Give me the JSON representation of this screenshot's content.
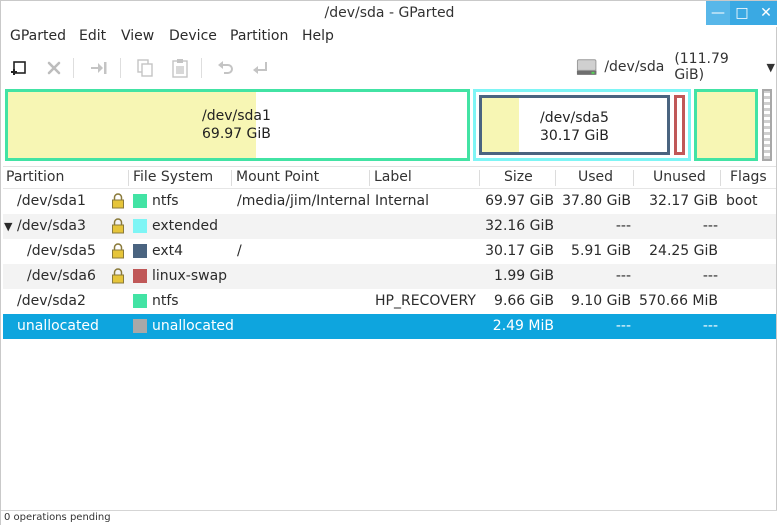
{
  "window": {
    "title": "/dev/sda - GParted"
  },
  "menu": [
    "GParted",
    "Edit",
    "View",
    "Device",
    "Partition",
    "Help"
  ],
  "toolbar": {
    "icons": [
      "new-partition-icon",
      "delete-icon",
      "resize-move-icon",
      "copy-icon",
      "paste-icon",
      "undo-icon",
      "apply-icon"
    ]
  },
  "device": {
    "name": "/dev/sda",
    "size": "(111.79 GiB)"
  },
  "disk_map": {
    "sda1": {
      "name": "/dev/sda1",
      "size": "69.97 GiB",
      "used_fraction": 0.54
    },
    "sda5": {
      "name": "/dev/sda5",
      "size": "30.17 GiB",
      "used_fraction": 0.2
    }
  },
  "colors": {
    "ntfs": "#42e3a4",
    "extended": "#7ef5f5",
    "ext4": "#4a6480",
    "linux_swap": "#c05858",
    "unallocated": "#a8a8a8",
    "used": "#f7f6b4",
    "selection": "#0ea5de"
  },
  "table": {
    "headers": [
      "Partition",
      "File System",
      "Mount Point",
      "Label",
      "Size",
      "Used",
      "Unused",
      "Flags"
    ],
    "rows": [
      {
        "partition": "/dev/sda1",
        "fs": "ntfs",
        "mount": "/media/jim/Internal",
        "label": "Internal",
        "size": "69.97 GiB",
        "used": "37.80 GiB",
        "unused": "32.17 GiB",
        "flags": "boot"
      },
      {
        "partition": "/dev/sda3",
        "fs": "extended",
        "mount": "",
        "label": "",
        "size": "32.16 GiB",
        "used": "---",
        "unused": "---",
        "flags": ""
      },
      {
        "partition": "/dev/sda5",
        "fs": "ext4",
        "mount": "/",
        "label": "",
        "size": "30.17 GiB",
        "used": "5.91 GiB",
        "unused": "24.25 GiB",
        "flags": ""
      },
      {
        "partition": "/dev/sda6",
        "fs": "linux-swap",
        "mount": "",
        "label": "",
        "size": "1.99 GiB",
        "used": "---",
        "unused": "---",
        "flags": ""
      },
      {
        "partition": "/dev/sda2",
        "fs": "ntfs",
        "mount": "",
        "label": "HP_RECOVERY",
        "size": "9.66 GiB",
        "used": "9.10 GiB",
        "unused": "570.66 MiB",
        "flags": ""
      },
      {
        "partition": "unallocated",
        "fs": "unallocated",
        "mount": "",
        "label": "",
        "size": "2.49 MiB",
        "used": "---",
        "unused": "---",
        "flags": ""
      }
    ]
  },
  "status": {
    "text": "0 operations pending"
  }
}
